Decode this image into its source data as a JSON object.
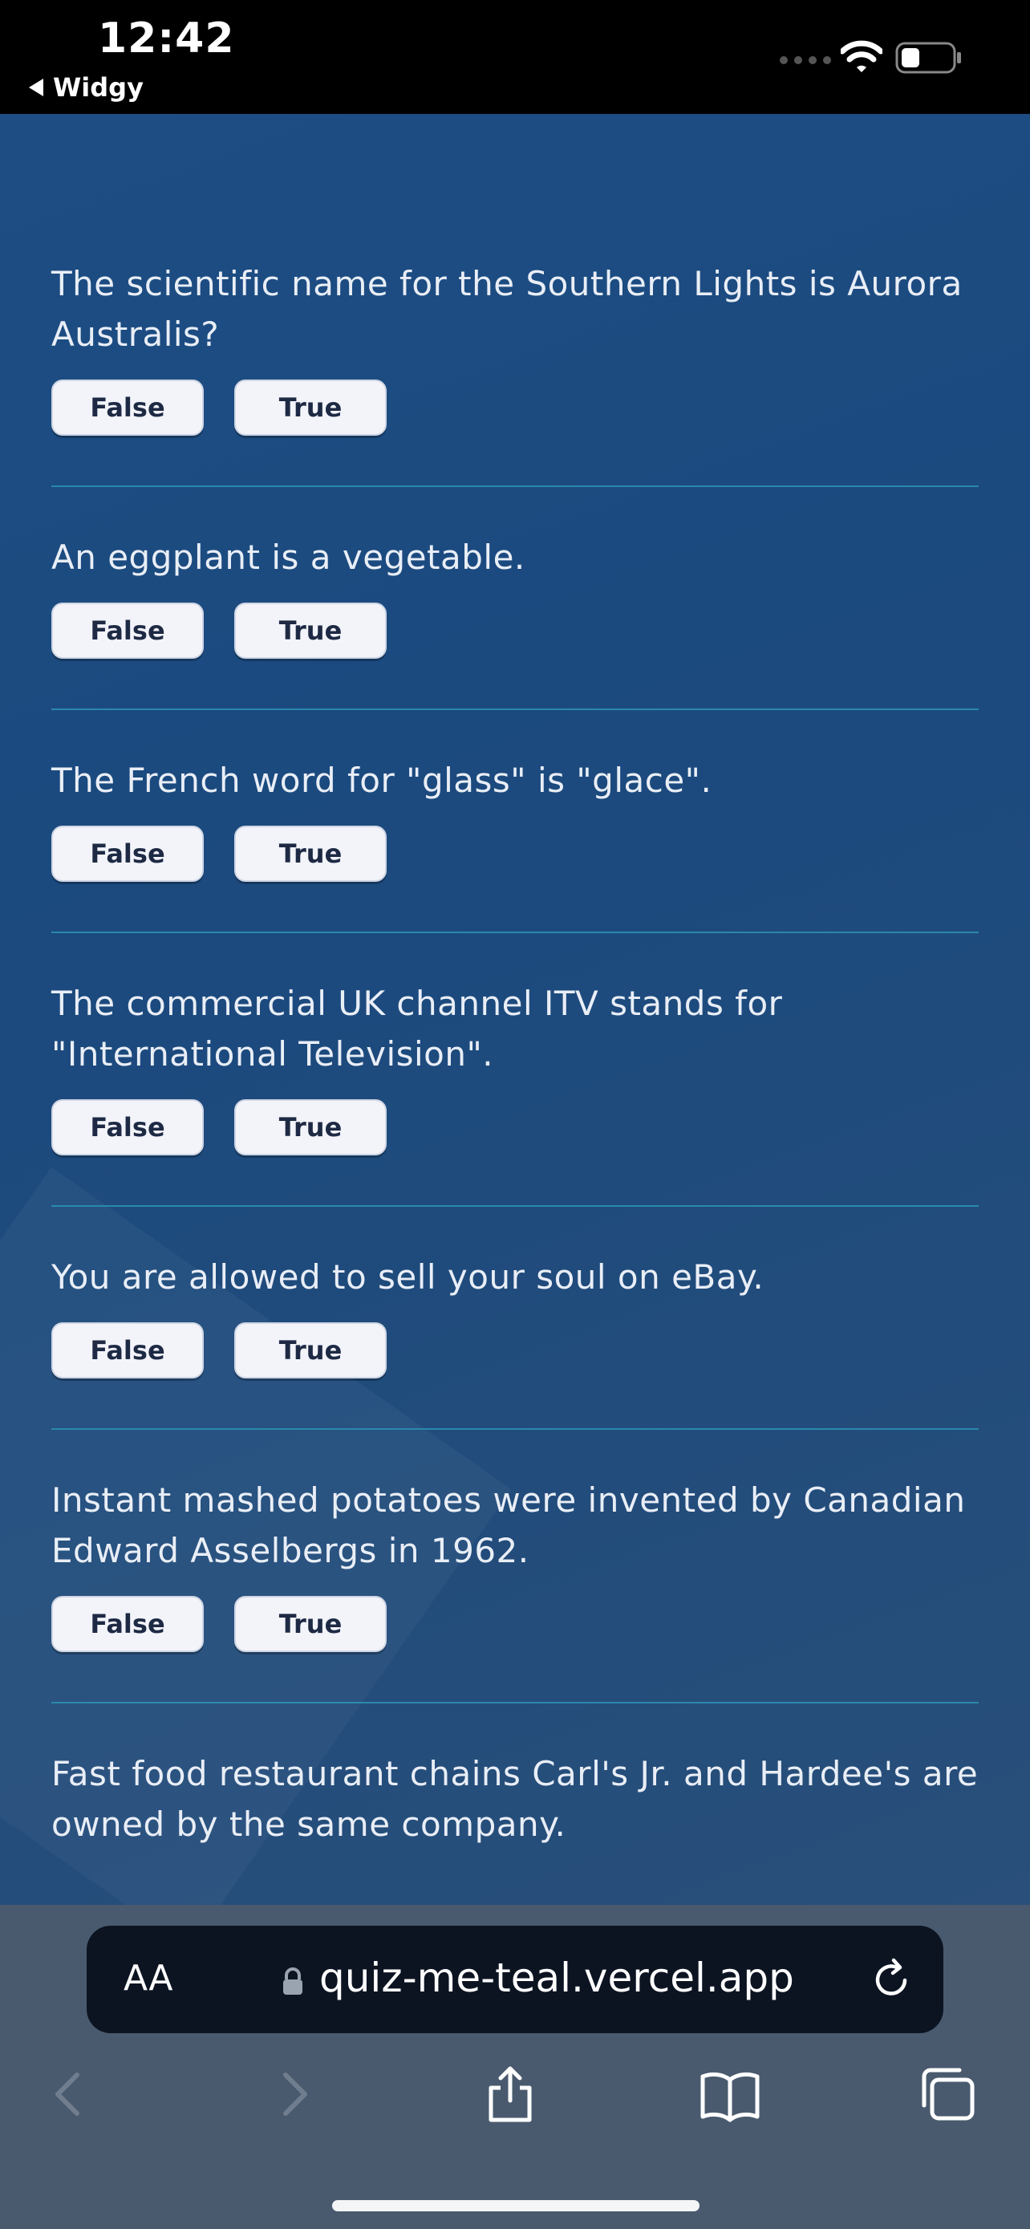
{
  "status_bar": {
    "time": "12:42",
    "back_app": "Widgy"
  },
  "questions": [
    {
      "text": "The scientific name for the Southern Lights is Aurora Australis?",
      "false_label": "False",
      "true_label": "True"
    },
    {
      "text": "An eggplant is a vegetable.",
      "false_label": "False",
      "true_label": "True"
    },
    {
      "text": "The French word for \"glass\" is \"glace\".",
      "false_label": "False",
      "true_label": "True"
    },
    {
      "text": "The commercial UK channel ITV stands for \"International Television\".",
      "false_label": "False",
      "true_label": "True"
    },
    {
      "text": "You are allowed to sell your soul on eBay.",
      "false_label": "False",
      "true_label": "True"
    },
    {
      "text": "Instant mashed potatoes were invented by Canadian Edward Asselbergs in 1962.",
      "false_label": "False",
      "true_label": "True"
    },
    {
      "text": "Fast food restaurant chains Carl's Jr. and Hardee's are owned by the same company."
    }
  ],
  "browser": {
    "text_size_label": "AA",
    "url": "quiz-me-teal.vercel.app"
  },
  "colors": {
    "page_bg": "#1d4d83",
    "divider": "#2b8fb3",
    "button_bg": "#f2f4fa",
    "button_text": "#1e2a44"
  }
}
